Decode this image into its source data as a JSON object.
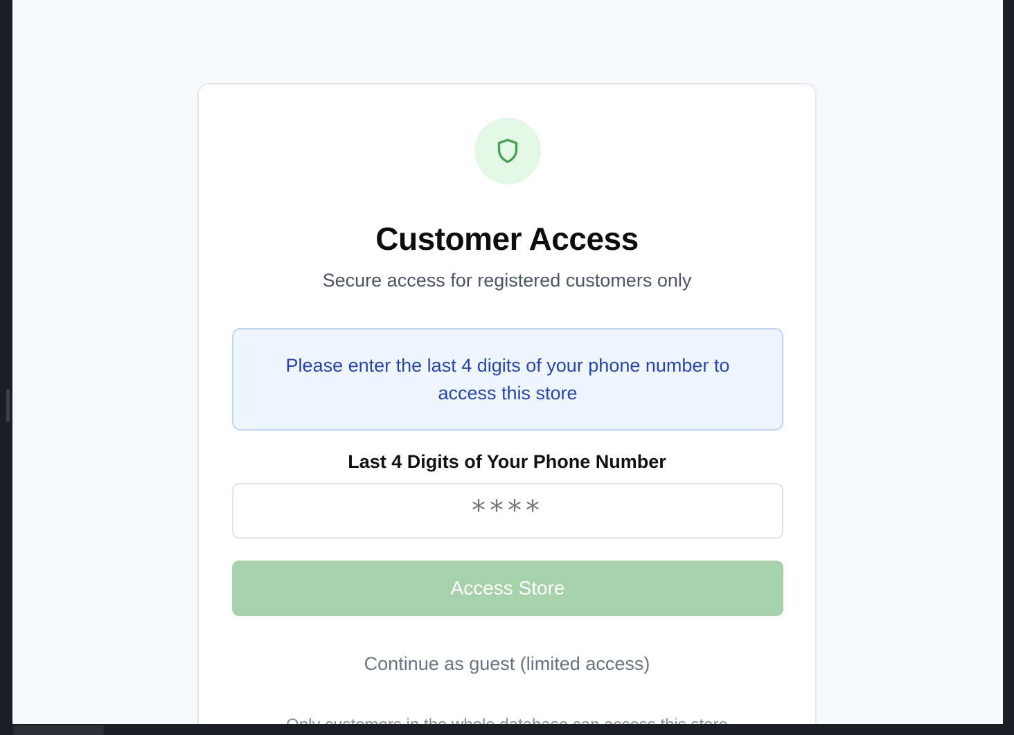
{
  "login": {
    "icon": "shield-icon",
    "title": "Customer Access",
    "subtitle": "Secure access for registered customers only",
    "info_message": "Please enter the last 4 digits of your phone number to access this store",
    "field_label": "Last 4 Digits of Your Phone Number",
    "input_placeholder": "****",
    "input_value": "",
    "button_label": "Access Store",
    "guest_link": "Continue as guest (limited access)",
    "footer_note": "Only customers in the whole database can access this store"
  },
  "colors": {
    "accent": "#4a9d54",
    "button_disabled": "#a6d1aa",
    "icon_bg": "#e3f7e6",
    "info_bg": "#eef5fd",
    "info_text": "#2945a8"
  }
}
